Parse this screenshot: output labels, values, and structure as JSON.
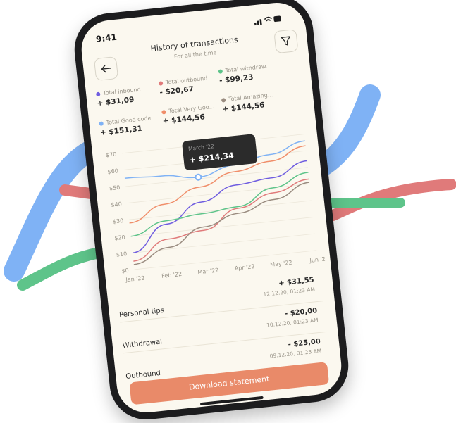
{
  "status_bar": {
    "time": "9:41"
  },
  "header": {
    "title": "History of transactions",
    "subtitle": "For all the time",
    "back_icon": "arrow-left-icon",
    "filter_icon": "filter-funnel-icon"
  },
  "legend": [
    {
      "label": "Total inbound",
      "value": "+ $31,09",
      "color": "#6f5de0"
    },
    {
      "label": "Total outbound",
      "value": "- $20,67",
      "color": "#e07a7a"
    },
    {
      "label": "Total withdraw.",
      "value": "- $99,23",
      "color": "#5ec48a"
    },
    {
      "label": "Total Good code",
      "value": "+ $151,31",
      "color": "#7fb2f5"
    },
    {
      "label": "Total Very Goo...",
      "value": "+ $144,56",
      "color": "#f08e6a"
    },
    {
      "label": "Total Amazing...",
      "value": "+ $144,56",
      "color": "#9a8c80"
    }
  ],
  "tooltip": {
    "month": "March '22",
    "value": "+ $214,34"
  },
  "chart_data": {
    "type": "line",
    "x": [
      "Jan '22",
      "Feb '22",
      "Mar '22",
      "Apr '22",
      "May '22",
      "Jun '2"
    ],
    "yticks": [
      "$0",
      "$10",
      "$20",
      "$30",
      "$40",
      "$50",
      "$60",
      "$70"
    ],
    "ylim": [
      0,
      70
    ],
    "grid": true,
    "series": [
      {
        "color": "#7fb2f5",
        "values": [
          55,
          54,
          51,
          56,
          60,
          66
        ]
      },
      {
        "color": "#f08e6a",
        "values": [
          28,
          37,
          45,
          52,
          56,
          63
        ]
      },
      {
        "color": "#6f5de0",
        "values": [
          10,
          25,
          36,
          44,
          46,
          54
        ]
      },
      {
        "color": "#5ec48a",
        "values": [
          20,
          27,
          29,
          31,
          40,
          47
        ]
      },
      {
        "color": "#e07a7a",
        "values": [
          5,
          16,
          19,
          30,
          37,
          43
        ]
      },
      {
        "color": "#9a8c80",
        "values": [
          3,
          11,
          21,
          27,
          33,
          41
        ]
      }
    ]
  },
  "transactions": [
    {
      "label": "Personal tips",
      "amount": "+ $31,55",
      "date": "12.12.20, 01:23 AM"
    },
    {
      "label": "Withdrawal",
      "amount": "- $20,00",
      "date": "10.12.20, 01:23 AM"
    },
    {
      "label": "Outbound",
      "amount": "- $25,00",
      "date": "09.12.20, 01:23 AM"
    }
  ],
  "download_label": "Download statement",
  "ribbon_colors": {
    "blue": "#7fb2f5",
    "red": "#e07a7a",
    "green": "#5ec48a"
  }
}
